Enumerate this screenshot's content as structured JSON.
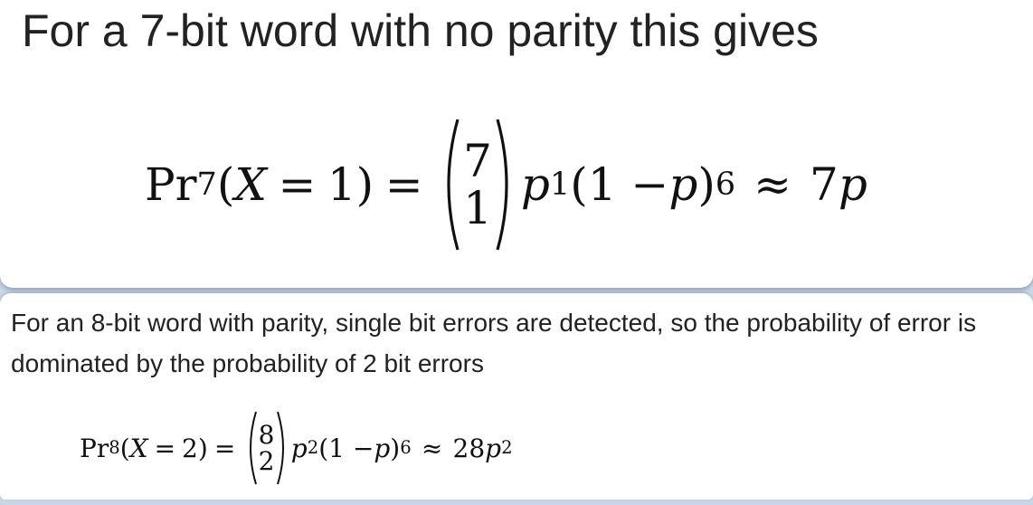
{
  "slide_top": {
    "heading": "For a 7-bit word with no parity this gives",
    "equation": {
      "prob": "Pr",
      "sub": "7",
      "open": "(",
      "var": "X",
      "eq_inner": "=",
      "value": "1",
      "close": ")",
      "eq": "=",
      "binom_n": "7",
      "binom_k": "1",
      "p1": "p",
      "exp1": "1",
      "factor_open": "(1 − ",
      "p2": "p",
      "factor_close": ")",
      "exp2": "6",
      "approx": "≈",
      "result_coef": "7",
      "result_var": "p"
    }
  },
  "slide_bottom": {
    "paragraph": "For an 8-bit word with parity, single bit errors are detected, so the probability of error is dominated by the probability of 2 bit errors",
    "equation": {
      "prob": "Pr",
      "sub": "8",
      "open": "(",
      "var": "X",
      "eq_inner": "=",
      "value": "2",
      "close": ")",
      "eq": "=",
      "binom_n": "8",
      "binom_k": "2",
      "p1": "p",
      "exp1": "2",
      "factor_open": "(1 − ",
      "p2": "p",
      "factor_close": ")",
      "exp2": "6",
      "approx": "≈",
      "result_coef": "28",
      "result_var": "p",
      "result_exp": "2"
    }
  }
}
